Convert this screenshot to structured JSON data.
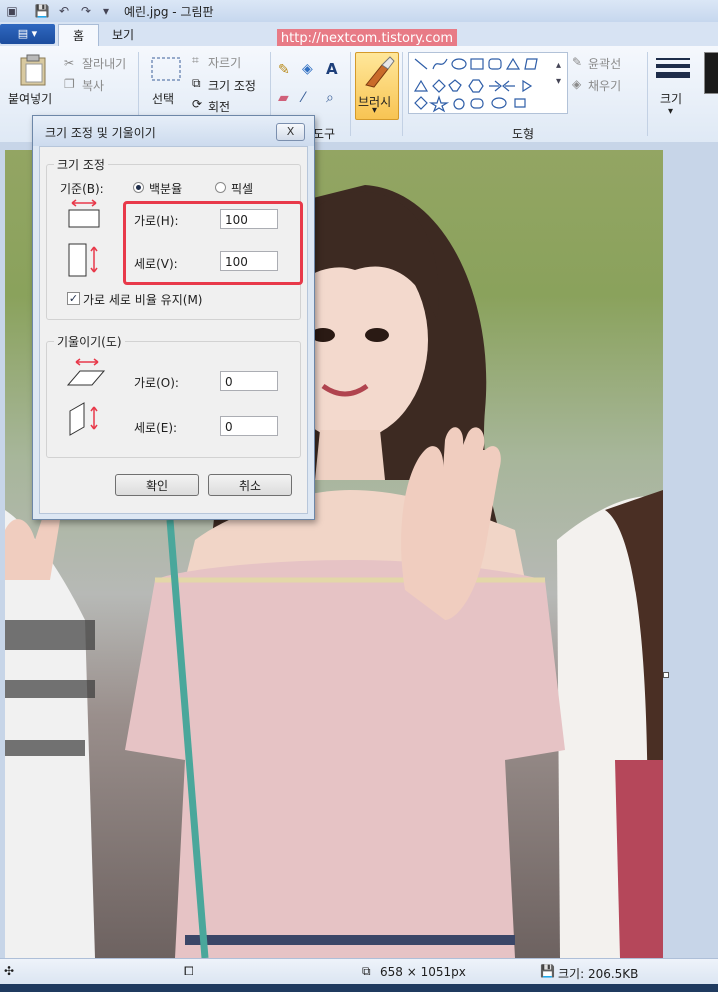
{
  "app": {
    "title": "예린.jpg - 그림판",
    "watermark": "http://nextcom.tistory.com"
  },
  "tabs": [
    {
      "label": "홈",
      "active": true
    },
    {
      "label": "보기",
      "active": false
    }
  ],
  "ribbon": {
    "clipboard": {
      "paste": "붙여넣기",
      "cut": "잘라내기",
      "copy": "복사"
    },
    "image": {
      "select": "선택",
      "crop": "자르기",
      "resize": "크기 조정",
      "rotate": "회전"
    },
    "tools_group": "도구",
    "brushes": "브러시",
    "shapes_group": "도형",
    "outline": "윤곽선",
    "fill": "채우기",
    "size": "크기"
  },
  "dialog": {
    "title": "크기 조정 및 기울이기",
    "close_label": "X",
    "resize": {
      "group_label": "크기 조정",
      "basis_label": "기준(B):",
      "percent_label": "백분율",
      "pixel_label": "픽셀",
      "selected": "percent",
      "horizontal_label": "가로(H):",
      "horizontal_value": "100",
      "vertical_label": "세로(V):",
      "vertical_value": "100",
      "keep_ratio_label": "가로 세로 비율 유지(M)",
      "keep_ratio_checked": true
    },
    "skew": {
      "group_label": "기울이기(도)",
      "horizontal_label": "가로(O):",
      "horizontal_value": "0",
      "vertical_label": "세로(E):",
      "vertical_value": "0"
    },
    "ok_label": "확인",
    "cancel_label": "취소"
  },
  "status": {
    "dimensions": "658 × 1051px",
    "file_size": "크기: 206.5KB"
  },
  "colors": {
    "highlight": "#e8394a",
    "accent": "#1c4d9e"
  }
}
